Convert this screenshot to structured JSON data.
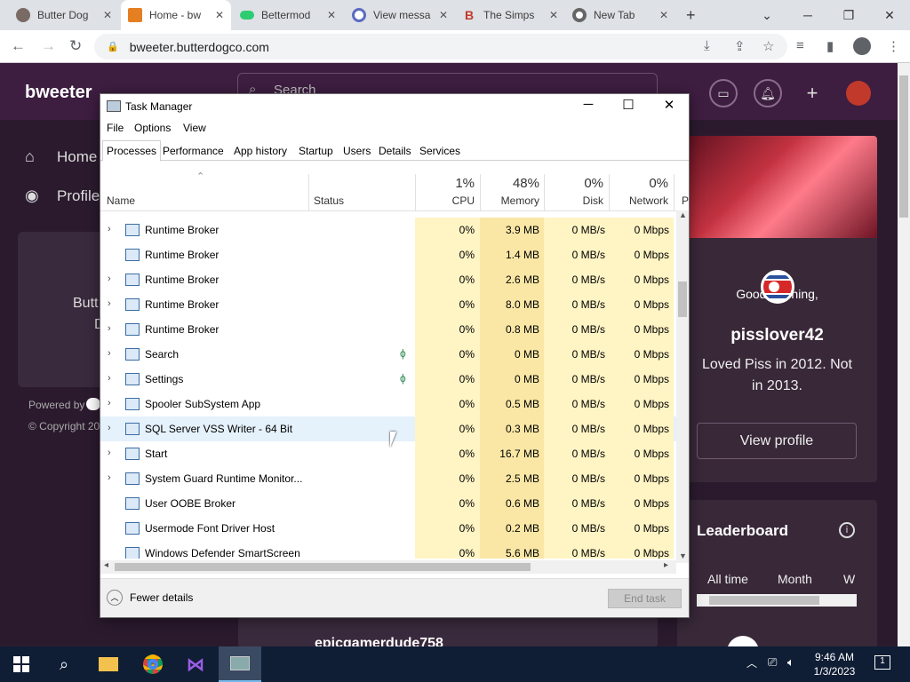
{
  "browser": {
    "tabs": [
      {
        "title": "Butter Dog",
        "icon": "butterdog-favicon",
        "color": "#8a8a8a"
      },
      {
        "title": "Home - bw",
        "icon": "bweeter-favicon",
        "color": "#e67e22"
      },
      {
        "title": "Bettermod",
        "icon": "toggle-favicon",
        "color": "#2ecc71"
      },
      {
        "title": "View messa",
        "icon": "at-sign-favicon",
        "color": "#5c6bc0"
      },
      {
        "title": "The Simps",
        "icon": "b-favicon",
        "color": "#c0392b"
      },
      {
        "title": "New Tab",
        "icon": "chrome-favicon",
        "color": "#9e9e9e"
      }
    ],
    "new_tab": "+",
    "url": "bweeter.butterdogco.com"
  },
  "site": {
    "logo": "bweeter",
    "search_placeholder": "Search",
    "nav": [
      {
        "label": "Home",
        "icon": "home-icon"
      },
      {
        "label": "Profile",
        "icon": "profile-icon"
      }
    ],
    "partial_text_1": "Butt",
    "partial_text_2": "D",
    "powered_by": "Powered by",
    "copyright": "© Copyright 20",
    "greeting": "Good morning,",
    "username": "pisslover42",
    "bio": "Loved Piss in 2012. Not in 2013.",
    "view_profile": "View profile",
    "leaderboard_title": "Leaderboard",
    "leaderboard_tabs": [
      "All time",
      "Month",
      "W"
    ],
    "bottom_user": "epicgamerdude758"
  },
  "task_manager": {
    "title": "Task Manager",
    "menu": [
      "File",
      "Options",
      "View"
    ],
    "tabs": [
      "Processes",
      "Performance",
      "App history",
      "Startup",
      "Users",
      "Details",
      "Services"
    ],
    "selected_tab": "Processes",
    "columns": {
      "name": "Name",
      "status": "Status",
      "cpu_pct": "1%",
      "cpu": "CPU",
      "mem_pct": "48%",
      "mem": "Memory",
      "disk_pct": "0%",
      "disk": "Disk",
      "net_pct": "0%",
      "net": "Network",
      "extra": "P"
    },
    "rows": [
      {
        "name": "Runtime Broker",
        "expand": true,
        "icon": "app-window-icon",
        "leaf": false,
        "cpu": "0%",
        "mem": "3.9 MB",
        "disk": "0 MB/s",
        "net": "0 Mbps"
      },
      {
        "name": "Runtime Broker",
        "expand": false,
        "icon": "app-window-icon",
        "leaf": false,
        "cpu": "0%",
        "mem": "1.4 MB",
        "disk": "0 MB/s",
        "net": "0 Mbps"
      },
      {
        "name": "Runtime Broker",
        "expand": true,
        "icon": "app-window-icon",
        "leaf": false,
        "cpu": "0%",
        "mem": "2.6 MB",
        "disk": "0 MB/s",
        "net": "0 Mbps"
      },
      {
        "name": "Runtime Broker",
        "expand": true,
        "icon": "app-window-icon",
        "leaf": false,
        "cpu": "0%",
        "mem": "8.0 MB",
        "disk": "0 MB/s",
        "net": "0 Mbps"
      },
      {
        "name": "Runtime Broker",
        "expand": true,
        "icon": "app-window-icon",
        "leaf": false,
        "cpu": "0%",
        "mem": "0.8 MB",
        "disk": "0 MB/s",
        "net": "0 Mbps"
      },
      {
        "name": "Search",
        "expand": true,
        "icon": "search-app-icon",
        "leaf": true,
        "cpu": "0%",
        "mem": "0 MB",
        "disk": "0 MB/s",
        "net": "0 Mbps"
      },
      {
        "name": "Settings",
        "expand": true,
        "icon": "settings-gear-icon",
        "leaf": true,
        "cpu": "0%",
        "mem": "0 MB",
        "disk": "0 MB/s",
        "net": "0 Mbps"
      },
      {
        "name": "Spooler SubSystem App",
        "expand": true,
        "icon": "printer-icon",
        "leaf": false,
        "cpu": "0%",
        "mem": "0.5 MB",
        "disk": "0 MB/s",
        "net": "0 Mbps"
      },
      {
        "name": "SQL Server VSS Writer - 64 Bit",
        "expand": true,
        "icon": "app-window-icon",
        "leaf": false,
        "cpu": "0%",
        "mem": "0.3 MB",
        "disk": "0 MB/s",
        "net": "0 Mbps"
      },
      {
        "name": "Start",
        "expand": true,
        "icon": "start-app-icon",
        "leaf": false,
        "cpu": "0%",
        "mem": "16.7 MB",
        "disk": "0 MB/s",
        "net": "0 Mbps"
      },
      {
        "name": "System Guard Runtime Monitor...",
        "expand": true,
        "icon": "app-window-icon",
        "leaf": false,
        "cpu": "0%",
        "mem": "2.5 MB",
        "disk": "0 MB/s",
        "net": "0 Mbps"
      },
      {
        "name": "User OOBE Broker",
        "expand": false,
        "icon": "app-window-icon",
        "leaf": false,
        "cpu": "0%",
        "mem": "0.6 MB",
        "disk": "0 MB/s",
        "net": "0 Mbps"
      },
      {
        "name": "Usermode Font Driver Host",
        "expand": false,
        "icon": "app-window-icon",
        "leaf": false,
        "cpu": "0%",
        "mem": "0.2 MB",
        "disk": "0 MB/s",
        "net": "0 Mbps"
      },
      {
        "name": "Windows Defender SmartScreen",
        "expand": false,
        "icon": "app-window-icon",
        "leaf": false,
        "cpu": "0%",
        "mem": "5.6 MB",
        "disk": "0 MB/s",
        "net": "0 Mbps"
      }
    ],
    "fewer_details": "Fewer details",
    "end_task": "End task"
  },
  "taskbar": {
    "time": "9:46 AM",
    "date": "1/3/2023",
    "notification_count": "1"
  }
}
